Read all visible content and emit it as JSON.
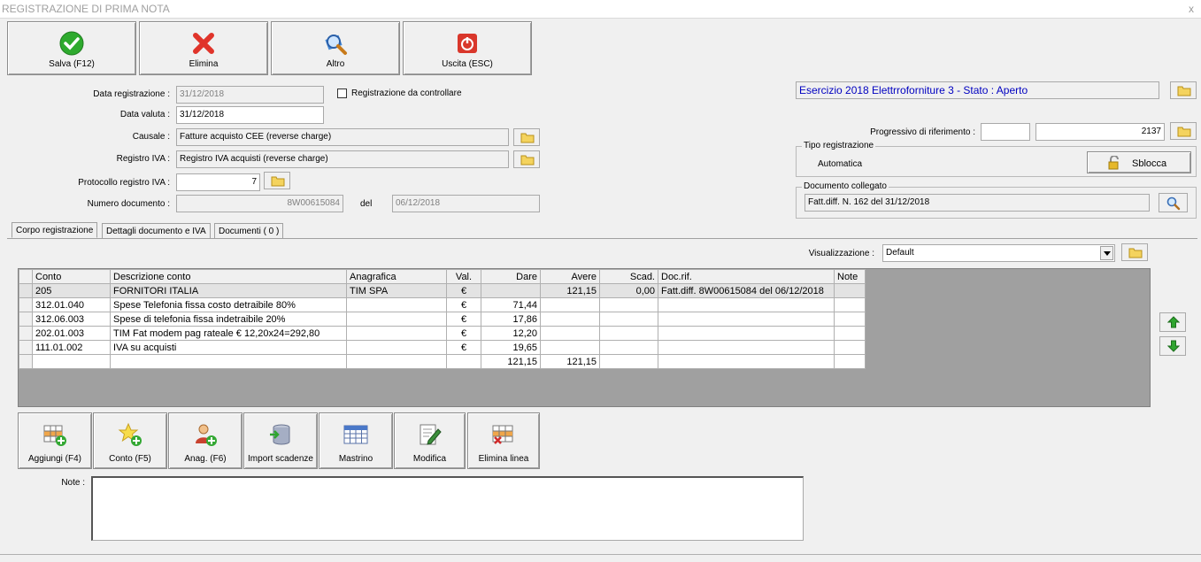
{
  "window": {
    "title": "REGISTRAZIONE DI PRIMA NOTA",
    "close": "x"
  },
  "toolbar": {
    "save": "Salva (F12)",
    "delete": "Elimina",
    "other": "Altro",
    "exit": "Uscita (ESC)"
  },
  "form": {
    "data_registrazione_label": "Data registrazione :",
    "data_registrazione_value": "31/12/2018",
    "registrazione_controllare_label": "Registrazione da controllare",
    "data_valuta_label": "Data valuta :",
    "data_valuta_value": "31/12/2018",
    "causale_label": "Causale :",
    "causale_value": "Fatture acquisto CEE (reverse charge)",
    "registro_iva_label": "Registro IVA :",
    "registro_iva_value": "Registro IVA acquisti (reverse charge)",
    "protocollo_label": "Protocollo registro IVA :",
    "protocollo_value": "7",
    "numero_documento_label": "Numero documento :",
    "numero_documento_value": "8W00615084",
    "del_label": "del",
    "del_value": "06/12/2018"
  },
  "right_panel": {
    "esercizio": "Esercizio 2018 Elettrroforniture 3 - Stato : Aperto",
    "progressivo_label": "Progressivo di riferimento :",
    "progressivo_value1": "",
    "progressivo_value2": "2137",
    "tipo_registrazione_title": "Tipo registrazione",
    "tipo_registrazione_value": "Automatica",
    "sblocca_label": "Sblocca",
    "documento_collegato_title": "Documento collegato",
    "documento_collegato_value": "Fatt.diff. N. 162 del 31/12/2018"
  },
  "tabs": [
    {
      "label": "Corpo registrazione"
    },
    {
      "label": "Dettagli documento e IVA"
    },
    {
      "label": "Documenti ( 0 )"
    }
  ],
  "visualizzazione": {
    "label": "Visualizzazione :",
    "value": "Default"
  },
  "grid": {
    "headers": [
      "Conto",
      "Descrizione conto",
      "Anagrafica",
      "Val.",
      "Dare",
      "Avere",
      "Scad.",
      "Doc.rif.",
      "Note"
    ],
    "rows": [
      {
        "conto": "205",
        "descrizione": "FORNITORI ITALIA",
        "anagrafica": "TIM SPA",
        "val": "€",
        "dare": "",
        "avere": "121,15",
        "scad": "0,00",
        "docrif": "Fatt.diff. 8W00615084 del 06/12/2018",
        "note": ""
      },
      {
        "conto": "312.01.040",
        "descrizione": "Spese Telefonia fissa costo detraibile 80%",
        "anagrafica": "",
        "val": "€",
        "dare": "71,44",
        "avere": "",
        "scad": "",
        "docrif": "",
        "note": ""
      },
      {
        "conto": "312.06.003",
        "descrizione": "Spese di telefonia fissa indetraibile 20%",
        "anagrafica": "",
        "val": "€",
        "dare": "17,86",
        "avere": "",
        "scad": "",
        "docrif": "",
        "note": ""
      },
      {
        "conto": "202.01.003",
        "descrizione": "TIM Fat modem pag rateale € 12,20x24=292,80",
        "anagrafica": "",
        "val": "€",
        "dare": "12,20",
        "avere": "",
        "scad": "",
        "docrif": "",
        "note": ""
      },
      {
        "conto": "111.01.002",
        "descrizione": "IVA su acquisti",
        "anagrafica": "",
        "val": "€",
        "dare": "19,65",
        "avere": "",
        "scad": "",
        "docrif": "",
        "note": ""
      }
    ],
    "totals": {
      "dare": "121,15",
      "avere": "121,15"
    }
  },
  "actions": {
    "aggiungi": "Aggiungi (F4)",
    "conto": "Conto (F5)",
    "anag": "Anag. (F6)",
    "import": "Import scadenze",
    "mastrino": "Mastrino",
    "modifica": "Modifica",
    "elimina_linea": "Elimina linea"
  },
  "notes": {
    "label": "Note :",
    "value": ""
  },
  "colors": {
    "accent_text": "#0000c0",
    "save_green": "#2eaa2e",
    "delete_red": "#e0342a",
    "exit_red": "#d9372b"
  }
}
